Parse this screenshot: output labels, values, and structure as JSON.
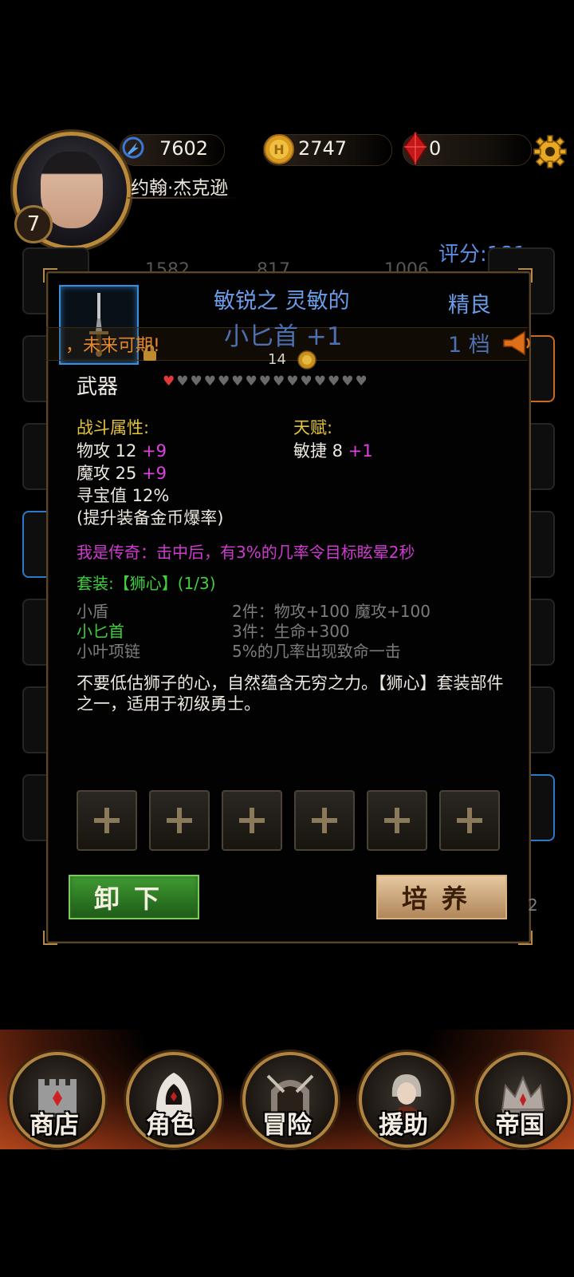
{
  "header": {
    "energy": "7602",
    "gold": "2747",
    "gems": "0",
    "player_name": "约翰·杰克逊",
    "level": "7",
    "score_label": "评分:",
    "score_value": "181"
  },
  "background": {
    "stats": [
      "1582",
      "817",
      "1006"
    ]
  },
  "item": {
    "notice": "，未来可期!",
    "prefix": "敏锐之  灵敏的",
    "name": "小匕首  +1",
    "quality": "精良",
    "tier": "1  档",
    "coin_count": "14",
    "category": "武器",
    "hearts_total": 15,
    "hearts_filled": 1
  },
  "combat": {
    "title": "战斗属性:",
    "stats": [
      {
        "label": "物攻 12 ",
        "bonus": "+9"
      },
      {
        "label": "魔攻 25 ",
        "bonus": "+9"
      },
      {
        "label": "寻宝值 12%",
        "bonus": ""
      },
      {
        "label": "(提升装备金币爆率)",
        "bonus": ""
      }
    ]
  },
  "talent": {
    "title": "天赋:",
    "stats": [
      {
        "label": "敏捷 8 ",
        "bonus": "+1"
      }
    ]
  },
  "legend_effect": "我是传奇：击中后，有3%的几率令目标眩晕2秒",
  "set": {
    "title": "套装:【狮心】(1/3)",
    "items": [
      {
        "name": "小盾",
        "owned": false
      },
      {
        "name": "小匕首",
        "owned": true
      },
      {
        "name": "小叶项链",
        "owned": false
      }
    ],
    "bonuses": [
      "2件：物攻+100 魔攻+100",
      "3件：生命+300",
      "5%的几率出现致命一击"
    ]
  },
  "description": "不要低估狮子的心，自然蕴含无穷之力。【狮心】套装部件之一，适用于初级勇士。",
  "buttons": {
    "unequip": "卸下",
    "train": "培养"
  },
  "side_number": "2",
  "nav": [
    {
      "label": "商店",
      "icon": "castle-icon"
    },
    {
      "label": "角色",
      "icon": "hooded-character-icon"
    },
    {
      "label": "冒险",
      "icon": "dungeon-gate-icon"
    },
    {
      "label": "援助",
      "icon": "ally-girl-icon"
    },
    {
      "label": "帝国",
      "icon": "crown-icon"
    }
  ],
  "colors": {
    "rare_blue": "#6b9ce8",
    "bonus_magenta": "#e040e0",
    "set_green": "#3fd03f",
    "section_gold": "#e6c53a",
    "notice_orange": "#e8872a"
  }
}
